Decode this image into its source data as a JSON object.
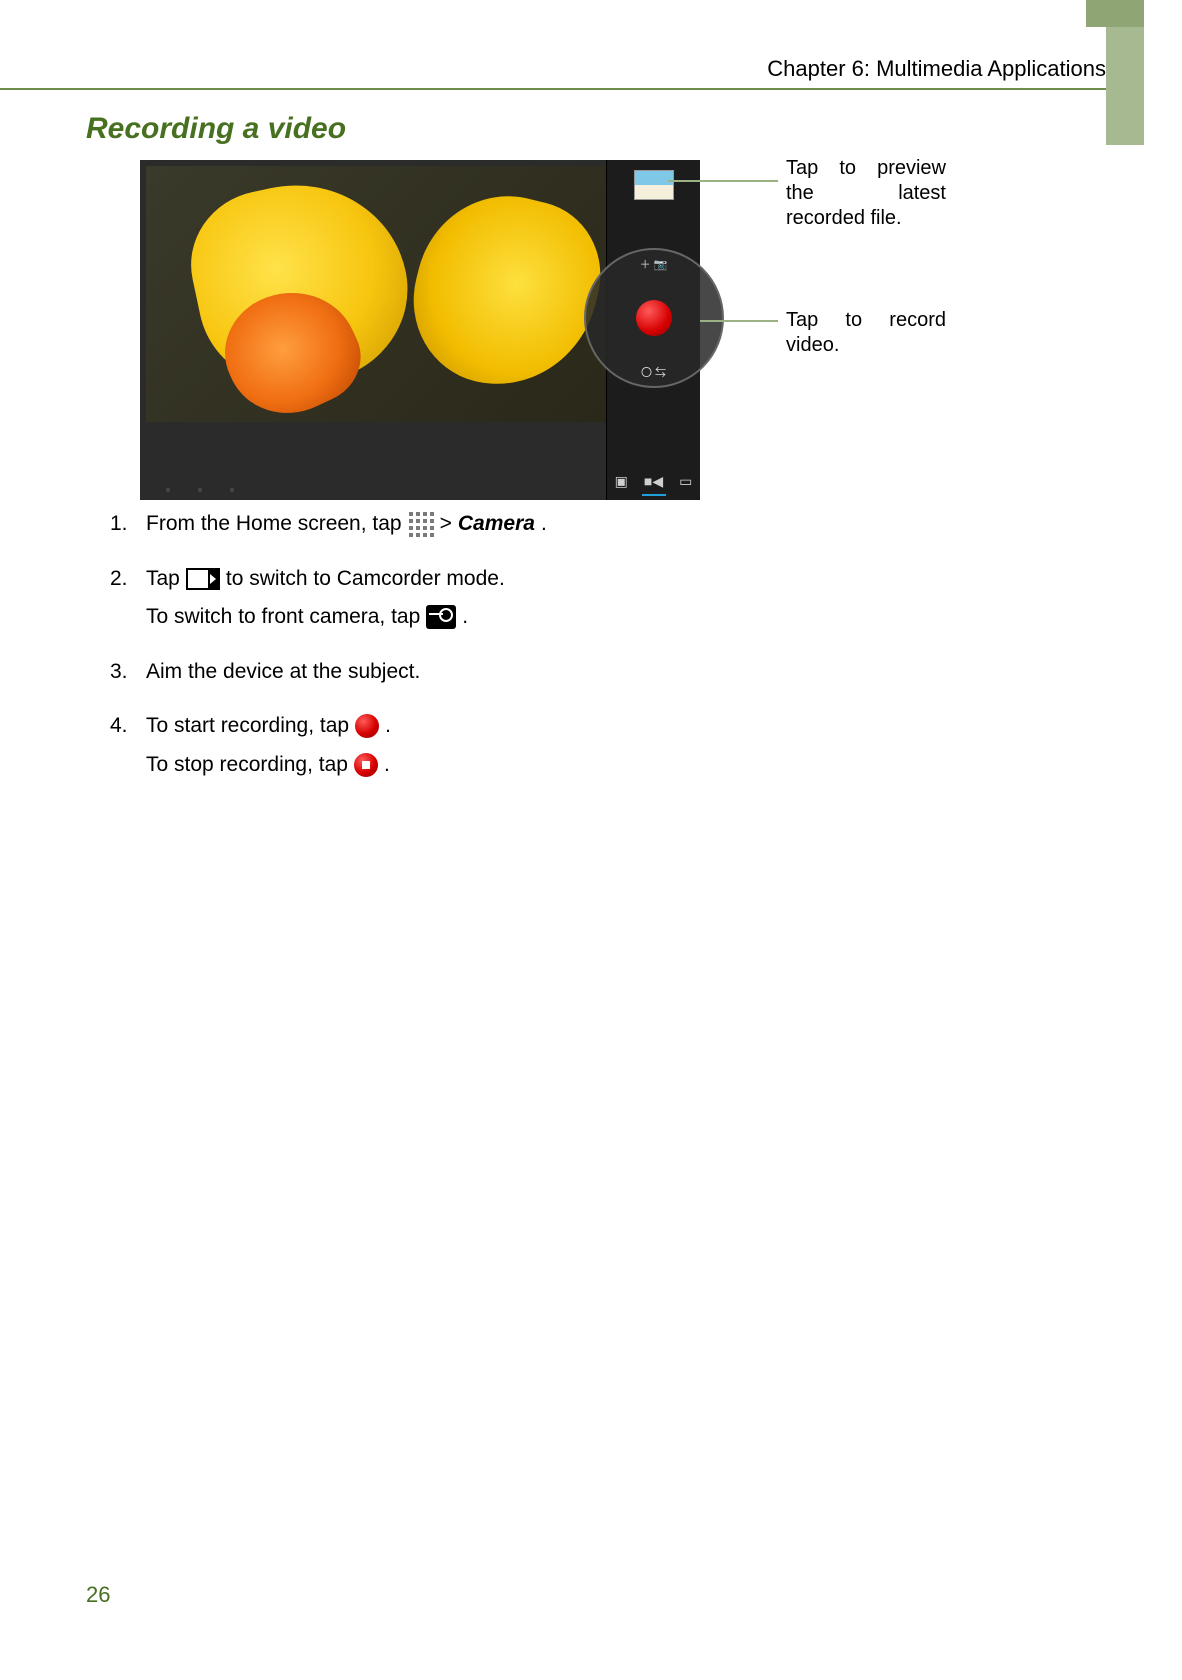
{
  "header": {
    "chapter": "Chapter 6: Multimedia Applications"
  },
  "section": {
    "title": "Recording a video"
  },
  "callouts": {
    "preview": "Tap to preview the latest recorded file.",
    "record": "Tap to record video."
  },
  "steps": {
    "s1": {
      "num": "1.",
      "prefix": "From the Home screen, tap",
      "mid": "  > ",
      "app": "Camera",
      "suffix": "."
    },
    "s2": {
      "num": "2.",
      "prefix": "Tap",
      "suffix": " to switch to Camcorder mode.",
      "line2_prefix": "To switch to front camera, tap",
      "line2_suffix": "."
    },
    "s3": {
      "num": "3.",
      "text": "Aim the device at the subject."
    },
    "s4": {
      "num": "4.",
      "prefix": "To start recording, tap",
      "suffix": ".",
      "line2_prefix": "To stop recording, tap",
      "line2_suffix": "."
    }
  },
  "page_number": "26"
}
